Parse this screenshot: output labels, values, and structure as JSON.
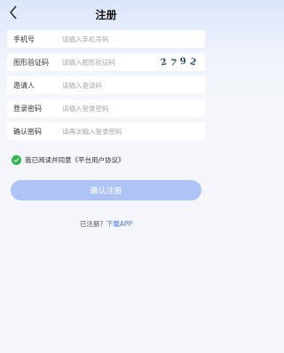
{
  "header": {
    "title": "注册"
  },
  "form": {
    "phone": {
      "label": "手机号",
      "placeholder": "请输入手机号码"
    },
    "captcha": {
      "label": "图形验证码",
      "placeholder": "请输入图形验证码",
      "code_chars": [
        "2",
        "7",
        "9",
        "2"
      ]
    },
    "inviter": {
      "label": "邀请人",
      "placeholder": "请输入邀请码"
    },
    "password": {
      "label": "登录密码",
      "placeholder": "请输入登录密码"
    },
    "confirm_password": {
      "label": "确认密码",
      "placeholder": "请再次输入登录密码"
    }
  },
  "agreement": {
    "checked": true,
    "text": "我已阅读并同意《平台用户协议》"
  },
  "submit": {
    "label": "确认注册"
  },
  "footer": {
    "prompt": "已注册？",
    "link": "下载APP"
  },
  "colors": {
    "accent": "#4a7bf0",
    "button": "#aec4f6",
    "check": "#2fb84a"
  }
}
